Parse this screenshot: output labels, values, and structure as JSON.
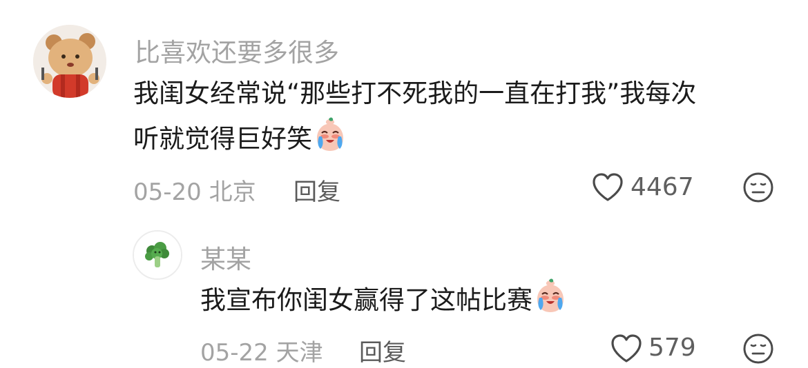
{
  "comments": [
    {
      "username": "比喜欢还要多很多",
      "line1": "我闺女经常说“那些打不死我的一直在打我”我每次",
      "line2": "听就觉得巨好笑",
      "emoji": "crying-face-emoji",
      "date_location": "05-20 北京",
      "reply_label": "回复",
      "likes": "4467",
      "avatar": "bear-avatar"
    },
    {
      "username": "某某",
      "line1": "我宣布你闺女赢得了这帖比赛",
      "emoji": "crying-face-emoji",
      "date_location": "05-22 天津",
      "reply_label": "回复",
      "likes": "579",
      "avatar": "broccoli-avatar"
    }
  ],
  "icons": {
    "like": "heart-outline-icon",
    "dislike": "neutral-face-icon"
  },
  "colors": {
    "username": "#a3a3a3",
    "text": "#1b1b1b",
    "meta": "#a3a3a3",
    "action": "#5a5a5a"
  }
}
